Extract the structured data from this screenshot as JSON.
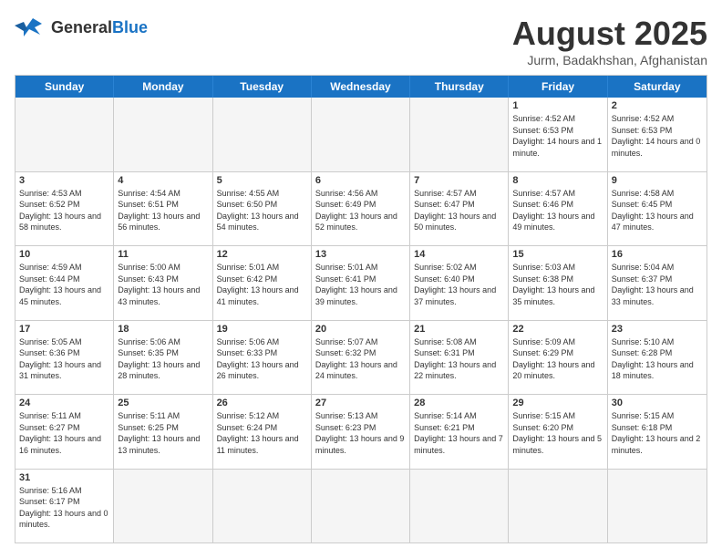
{
  "logo": {
    "text_general": "General",
    "text_blue": "Blue"
  },
  "title": "August 2025",
  "subtitle": "Jurm, Badakhshan, Afghanistan",
  "header_days": [
    "Sunday",
    "Monday",
    "Tuesday",
    "Wednesday",
    "Thursday",
    "Friday",
    "Saturday"
  ],
  "rows": [
    [
      {
        "day": "",
        "info": "",
        "empty": true
      },
      {
        "day": "",
        "info": "",
        "empty": true
      },
      {
        "day": "",
        "info": "",
        "empty": true
      },
      {
        "day": "",
        "info": "",
        "empty": true
      },
      {
        "day": "",
        "info": "",
        "empty": true
      },
      {
        "day": "1",
        "info": "Sunrise: 4:52 AM\nSunset: 6:53 PM\nDaylight: 14 hours and 1 minute.",
        "empty": false
      },
      {
        "day": "2",
        "info": "Sunrise: 4:52 AM\nSunset: 6:53 PM\nDaylight: 14 hours and 0 minutes.",
        "empty": false
      }
    ],
    [
      {
        "day": "3",
        "info": "Sunrise: 4:53 AM\nSunset: 6:52 PM\nDaylight: 13 hours and 58 minutes.",
        "empty": false
      },
      {
        "day": "4",
        "info": "Sunrise: 4:54 AM\nSunset: 6:51 PM\nDaylight: 13 hours and 56 minutes.",
        "empty": false
      },
      {
        "day": "5",
        "info": "Sunrise: 4:55 AM\nSunset: 6:50 PM\nDaylight: 13 hours and 54 minutes.",
        "empty": false
      },
      {
        "day": "6",
        "info": "Sunrise: 4:56 AM\nSunset: 6:49 PM\nDaylight: 13 hours and 52 minutes.",
        "empty": false
      },
      {
        "day": "7",
        "info": "Sunrise: 4:57 AM\nSunset: 6:47 PM\nDaylight: 13 hours and 50 minutes.",
        "empty": false
      },
      {
        "day": "8",
        "info": "Sunrise: 4:57 AM\nSunset: 6:46 PM\nDaylight: 13 hours and 49 minutes.",
        "empty": false
      },
      {
        "day": "9",
        "info": "Sunrise: 4:58 AM\nSunset: 6:45 PM\nDaylight: 13 hours and 47 minutes.",
        "empty": false
      }
    ],
    [
      {
        "day": "10",
        "info": "Sunrise: 4:59 AM\nSunset: 6:44 PM\nDaylight: 13 hours and 45 minutes.",
        "empty": false
      },
      {
        "day": "11",
        "info": "Sunrise: 5:00 AM\nSunset: 6:43 PM\nDaylight: 13 hours and 43 minutes.",
        "empty": false
      },
      {
        "day": "12",
        "info": "Sunrise: 5:01 AM\nSunset: 6:42 PM\nDaylight: 13 hours and 41 minutes.",
        "empty": false
      },
      {
        "day": "13",
        "info": "Sunrise: 5:01 AM\nSunset: 6:41 PM\nDaylight: 13 hours and 39 minutes.",
        "empty": false
      },
      {
        "day": "14",
        "info": "Sunrise: 5:02 AM\nSunset: 6:40 PM\nDaylight: 13 hours and 37 minutes.",
        "empty": false
      },
      {
        "day": "15",
        "info": "Sunrise: 5:03 AM\nSunset: 6:38 PM\nDaylight: 13 hours and 35 minutes.",
        "empty": false
      },
      {
        "day": "16",
        "info": "Sunrise: 5:04 AM\nSunset: 6:37 PM\nDaylight: 13 hours and 33 minutes.",
        "empty": false
      }
    ],
    [
      {
        "day": "17",
        "info": "Sunrise: 5:05 AM\nSunset: 6:36 PM\nDaylight: 13 hours and 31 minutes.",
        "empty": false
      },
      {
        "day": "18",
        "info": "Sunrise: 5:06 AM\nSunset: 6:35 PM\nDaylight: 13 hours and 28 minutes.",
        "empty": false
      },
      {
        "day": "19",
        "info": "Sunrise: 5:06 AM\nSunset: 6:33 PM\nDaylight: 13 hours and 26 minutes.",
        "empty": false
      },
      {
        "day": "20",
        "info": "Sunrise: 5:07 AM\nSunset: 6:32 PM\nDaylight: 13 hours and 24 minutes.",
        "empty": false
      },
      {
        "day": "21",
        "info": "Sunrise: 5:08 AM\nSunset: 6:31 PM\nDaylight: 13 hours and 22 minutes.",
        "empty": false
      },
      {
        "day": "22",
        "info": "Sunrise: 5:09 AM\nSunset: 6:29 PM\nDaylight: 13 hours and 20 minutes.",
        "empty": false
      },
      {
        "day": "23",
        "info": "Sunrise: 5:10 AM\nSunset: 6:28 PM\nDaylight: 13 hours and 18 minutes.",
        "empty": false
      }
    ],
    [
      {
        "day": "24",
        "info": "Sunrise: 5:11 AM\nSunset: 6:27 PM\nDaylight: 13 hours and 16 minutes.",
        "empty": false
      },
      {
        "day": "25",
        "info": "Sunrise: 5:11 AM\nSunset: 6:25 PM\nDaylight: 13 hours and 13 minutes.",
        "empty": false
      },
      {
        "day": "26",
        "info": "Sunrise: 5:12 AM\nSunset: 6:24 PM\nDaylight: 13 hours and 11 minutes.",
        "empty": false
      },
      {
        "day": "27",
        "info": "Sunrise: 5:13 AM\nSunset: 6:23 PM\nDaylight: 13 hours and 9 minutes.",
        "empty": false
      },
      {
        "day": "28",
        "info": "Sunrise: 5:14 AM\nSunset: 6:21 PM\nDaylight: 13 hours and 7 minutes.",
        "empty": false
      },
      {
        "day": "29",
        "info": "Sunrise: 5:15 AM\nSunset: 6:20 PM\nDaylight: 13 hours and 5 minutes.",
        "empty": false
      },
      {
        "day": "30",
        "info": "Sunrise: 5:15 AM\nSunset: 6:18 PM\nDaylight: 13 hours and 2 minutes.",
        "empty": false
      }
    ],
    [
      {
        "day": "31",
        "info": "Sunrise: 5:16 AM\nSunset: 6:17 PM\nDaylight: 13 hours and 0 minutes.",
        "empty": false
      },
      {
        "day": "",
        "info": "",
        "empty": true
      },
      {
        "day": "",
        "info": "",
        "empty": true
      },
      {
        "day": "",
        "info": "",
        "empty": true
      },
      {
        "day": "",
        "info": "",
        "empty": true
      },
      {
        "day": "",
        "info": "",
        "empty": true
      },
      {
        "day": "",
        "info": "",
        "empty": true
      }
    ]
  ]
}
